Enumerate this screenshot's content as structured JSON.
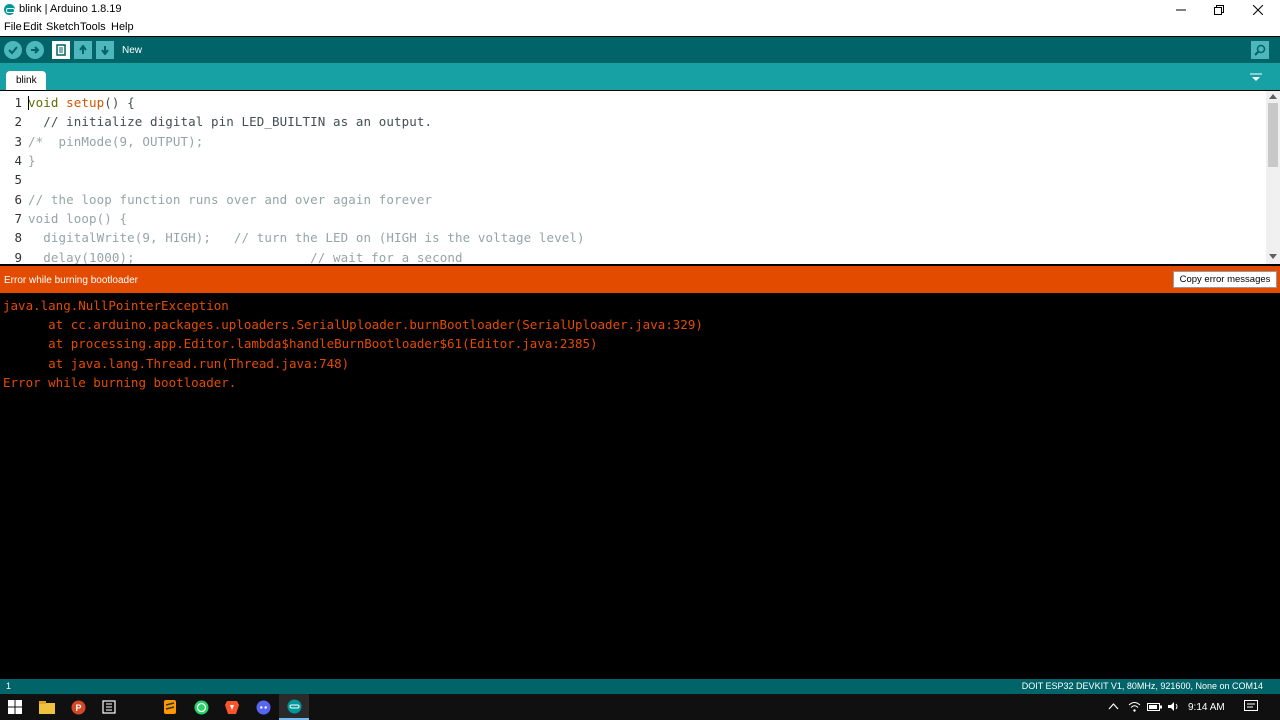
{
  "window": {
    "title": "blink | Arduino 1.8.19"
  },
  "menu": [
    "File",
    "Edit",
    "Sketch",
    "Tools",
    "Help"
  ],
  "toolbar": {
    "new_label": "New"
  },
  "tabs": [
    {
      "label": "blink"
    }
  ],
  "editor": {
    "line_numbers": [
      "1",
      "2",
      "3",
      "4",
      "5",
      "6",
      "7",
      "8",
      "9"
    ]
  },
  "error_bar": {
    "status": "Error while burning bootloader",
    "copy_button": "Copy error messages"
  },
  "console": {
    "lines": [
      "java.lang.NullPointerException",
      "\tat cc.arduino.packages.uploaders.SerialUploader.burnBootloader(SerialUploader.java:329)",
      "\tat processing.app.Editor.lambda$handleBurnBootloader$61(Editor.java:2385)",
      "\tat java.lang.Thread.run(Thread.java:748)",
      "Error while burning bootloader."
    ]
  },
  "status_bar": {
    "line": "1",
    "board": "DOIT ESP32 DEVKIT V1, 80MHz, 921600, None on COM14"
  },
  "taskbar": {
    "time": "9:14 AM"
  },
  "colors": {
    "teal_dark": "#006468",
    "teal_tab": "#17a1a5",
    "error_orange": "#e34c00"
  }
}
